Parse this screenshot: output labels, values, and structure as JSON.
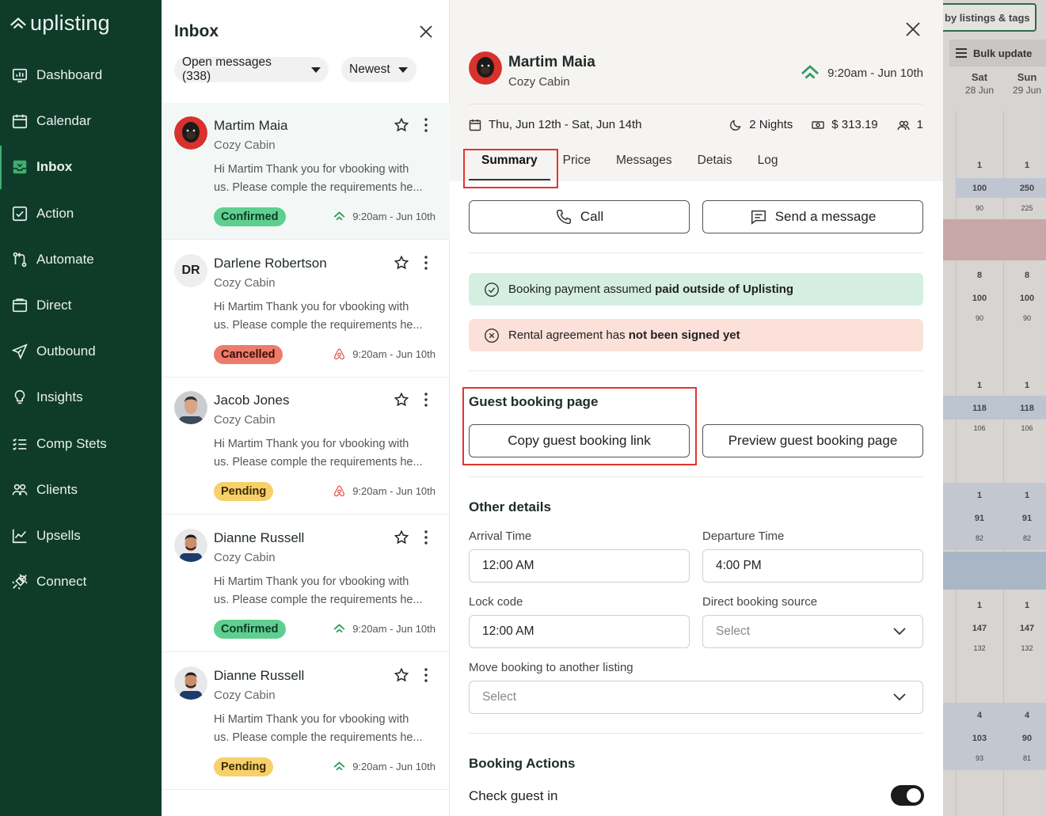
{
  "brand": {
    "logo_text": "uplisting",
    "accent": "#0f3b2b",
    "highlight_color": "#e3342f"
  },
  "sidebar": {
    "items": [
      {
        "label": "Dashboard",
        "icon": "dashboard-icon"
      },
      {
        "label": "Calendar",
        "icon": "calendar-icon"
      },
      {
        "label": "Inbox",
        "icon": "inbox-icon",
        "active": true
      },
      {
        "label": "Action",
        "icon": "action-check-icon"
      },
      {
        "label": "Automate",
        "icon": "automate-icon"
      },
      {
        "label": "Direct",
        "icon": "direct-icon"
      },
      {
        "label": "Outbound",
        "icon": "outbound-send-icon"
      },
      {
        "label": "Insights",
        "icon": "lightbulb-icon"
      },
      {
        "label": "Comp Stets",
        "icon": "list-icon"
      },
      {
        "label": "Clients",
        "icon": "clients-icon"
      },
      {
        "label": "Upsells",
        "icon": "chart-line-icon"
      },
      {
        "label": "Connect",
        "icon": "connect-plug-icon"
      }
    ]
  },
  "inbox": {
    "title": "Inbox",
    "filter_label": "Open messages (338)",
    "sort_label": "Newest",
    "conversations": [
      {
        "name": "Martim Maia",
        "listing": "Cozy Cabin",
        "message_line1": "Hi Martim Thank you for vbooking with",
        "message_line2": "us. Please comple the requirements he...",
        "status": "Confirmed",
        "time": "9:20am - Jun 10th",
        "channel": "uplisting",
        "initials": ""
      },
      {
        "name": "Darlene Robertson",
        "listing": "Cozy Cabin",
        "message_line1": "Hi Martim Thank you for vbooking with",
        "message_line2": "us. Please comple the requirements he...",
        "status": "Cancelled",
        "time": "9:20am - Jun 10th",
        "channel": "airbnb",
        "initials": "DR"
      },
      {
        "name": "Jacob Jones",
        "listing": "Cozy Cabin",
        "message_line1": "Hi Martim Thank you for vbooking with",
        "message_line2": "us. Please comple the requirements he...",
        "status": "Pending",
        "time": "9:20am - Jun 10th",
        "channel": "airbnb",
        "initials": ""
      },
      {
        "name": "Dianne Russell",
        "listing": "Cozy Cabin",
        "message_line1": "Hi Martim Thank you for vbooking with",
        "message_line2": "us. Please comple the requirements he...",
        "status": "Confirmed",
        "time": "9:20am - Jun 10th",
        "channel": "uplisting",
        "initials": ""
      },
      {
        "name": "Dianne Russell",
        "listing": "Cozy Cabin",
        "message_line1": "Hi Martim Thank you for vbooking with",
        "message_line2": "us. Please comple the requirements he...",
        "status": "Pending",
        "time": "9:20am - Jun 10th",
        "channel": "uplisting",
        "initials": ""
      }
    ]
  },
  "detail": {
    "guest_name": "Martim Maia",
    "listing": "Cozy Cabin",
    "time": "9:20am - Jun 10th",
    "dates": "Thu, Jun 12th - Sat, Jun 14th",
    "nights": "2 Nights",
    "price": "$ 313.19",
    "guests": "1",
    "tabs": [
      "Summary",
      "Price",
      "Messages",
      "Detais",
      "Log"
    ],
    "call_label": "Call",
    "send_label": "Send a message",
    "notice_payment_prefix": "Booking payment assumed ",
    "notice_payment_bold": "paid outside of Uplisting",
    "notice_agreement_prefix": "Rental agreement has ",
    "notice_agreement_bold": "not been signed yet",
    "guest_page_title": "Guest booking page",
    "copy_link_label": "Copy guest booking link",
    "preview_label": "Preview guest booking page",
    "other_details_title": "Other details",
    "arrival_label": "Arrival Time",
    "arrival_value": "12:00 AM",
    "departure_label": "Departure Time",
    "departure_value": "4:00 PM",
    "lock_label": "Lock code",
    "lock_value": "12:00 AM",
    "source_label": "Direct booking source",
    "source_placeholder": "Select",
    "move_label": "Move booking to another listing",
    "move_placeholder": "Select",
    "actions_title": "Booking Actions",
    "check_in_label": "Check guest in",
    "check_in_on": true
  },
  "calendar_bg": {
    "tag_filter": "by listings & tags",
    "bulk_update": "Bulk update",
    "days": [
      {
        "day": "Sat",
        "date": "28 Jun"
      },
      {
        "day": "Sun",
        "date": "29 Jun"
      }
    ],
    "rows": [
      {
        "a": [
          "1",
          "100",
          "90"
        ],
        "b": [
          "1",
          "250",
          "225"
        ]
      },
      {
        "a": [
          "8",
          "100",
          "90"
        ],
        "b": [
          "8",
          "100",
          "90"
        ]
      },
      {
        "a": [
          "1",
          "118",
          "106"
        ],
        "b": [
          "1",
          "118",
          "106"
        ]
      },
      {
        "a": [
          "1",
          "91",
          "82"
        ],
        "b": [
          "1",
          "91",
          "82"
        ]
      },
      {
        "a": [
          "1",
          "147",
          "132"
        ],
        "b": [
          "1",
          "147",
          "132"
        ]
      },
      {
        "a": [
          "4",
          "103",
          "93"
        ],
        "b": [
          "4",
          "90",
          "81"
        ]
      }
    ]
  }
}
